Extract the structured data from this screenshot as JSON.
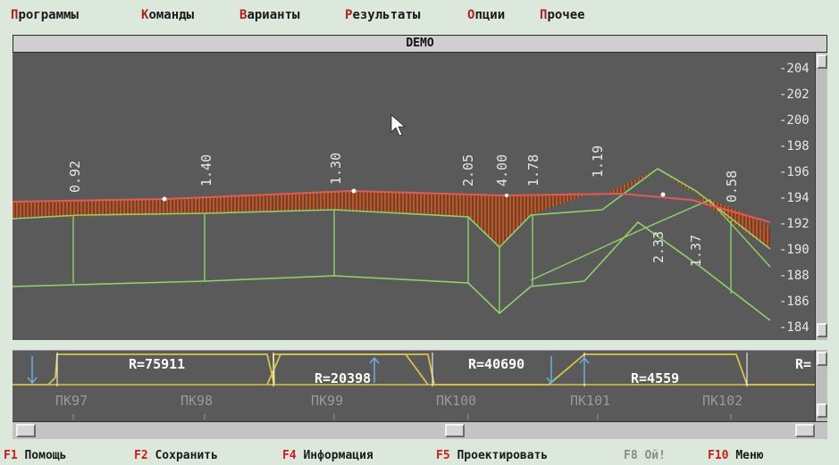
{
  "menu": [
    {
      "hotkey": "П",
      "rest": "рограммы"
    },
    {
      "hotkey": "К",
      "rest": "оманды"
    },
    {
      "hotkey": "В",
      "rest": "арианты"
    },
    {
      "hotkey": "Р",
      "rest": "езультаты"
    },
    {
      "hotkey": "О",
      "rest": "пции"
    },
    {
      "hotkey": "П",
      "rest": "рочее"
    }
  ],
  "window_title": "DEMO",
  "profile": {
    "elevation_ticks": [
      "-204",
      "-202",
      "-200",
      "-198",
      "-196",
      "-194",
      "-192",
      "-190",
      "-188",
      "-186",
      "-184"
    ],
    "depth_labels": [
      "0.92",
      "1.40",
      "1.30",
      "2.05",
      "4.00",
      "1.78",
      "1.19",
      "0.58"
    ],
    "fill_labels": [
      "2.33",
      "1.37"
    ]
  },
  "plan": {
    "curve_radii": [
      "R=75911",
      "R=20398",
      "R=40690",
      "R=4559",
      "R="
    ]
  },
  "stations": [
    "ПК97",
    "ПК98",
    "ПК99",
    "ПК100",
    "ПК101",
    "ПК102"
  ],
  "fkeys": [
    {
      "key": "F1",
      "label": "Помощь"
    },
    {
      "key": "F2",
      "label": "Сохранить"
    },
    {
      "key": "F4",
      "label": "Информация"
    },
    {
      "key": "F5",
      "label": "Проектировать"
    },
    {
      "key": "F8",
      "label": "Ой!"
    },
    {
      "key": "F10",
      "label": "Меню"
    }
  ],
  "colors": {
    "background": "#dde8dc",
    "panel": "#5a5a5a",
    "hotkey": "#b02020",
    "design_line": "#e05a5a",
    "ground_line": "#8fd16a",
    "cut_hatch": "#b8532e",
    "label_text": "#e8e8e8",
    "radius_text": "#ffffff",
    "plan_line": "#d8c24a"
  }
}
